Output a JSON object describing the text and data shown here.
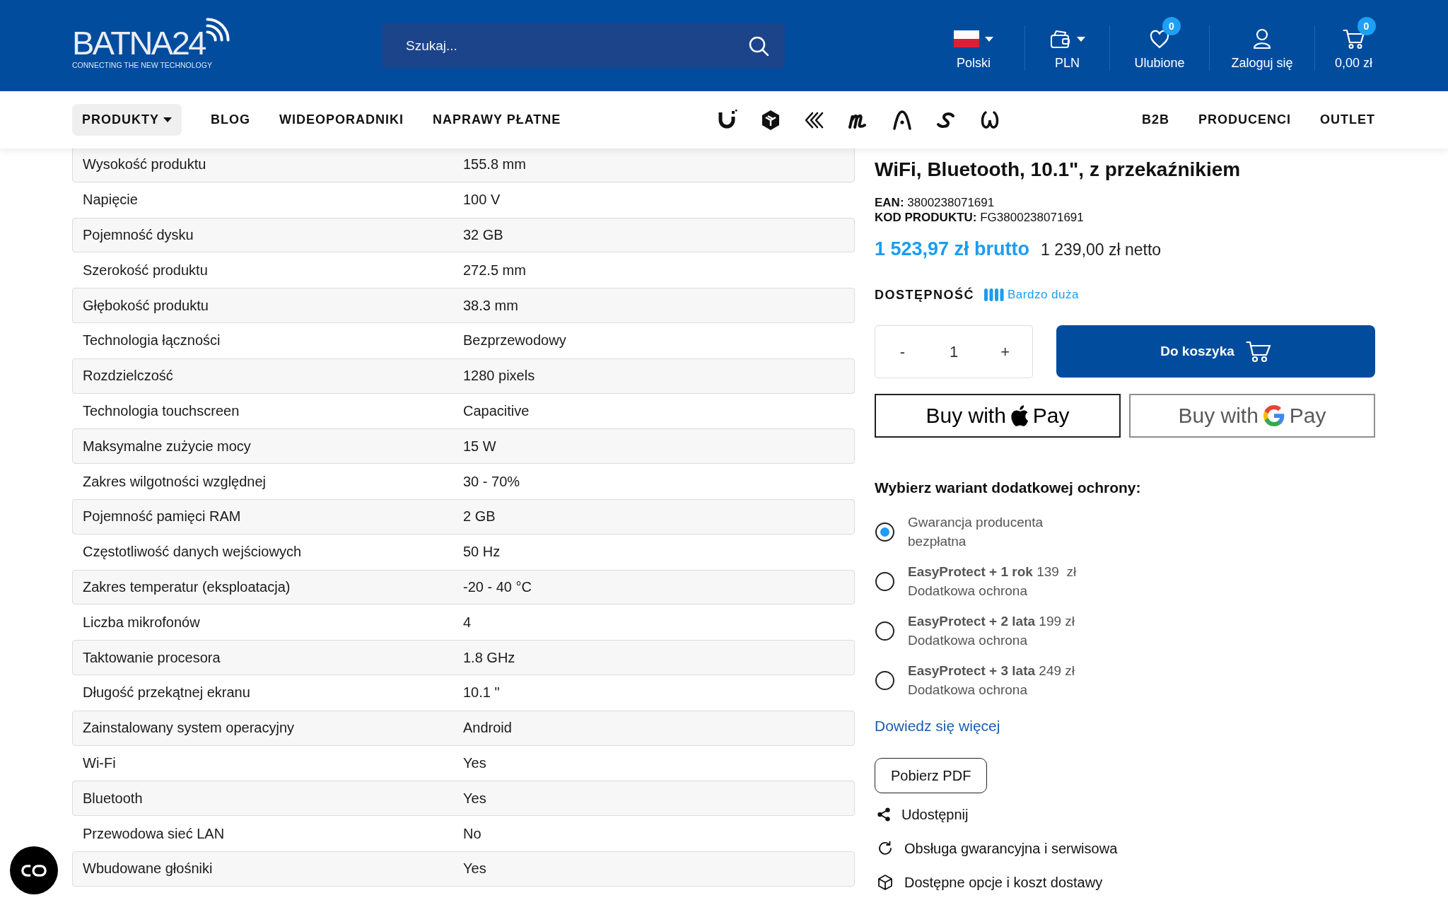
{
  "header": {
    "logo": {
      "wordmark": "BATNA24",
      "tagline": "CONNECTING THE NEW TECHNOLOGY"
    },
    "search": {
      "placeholder": "Szukaj..."
    },
    "actions": [
      {
        "kind": "language",
        "label": "Polski"
      },
      {
        "kind": "currency",
        "label": "PLN"
      },
      {
        "kind": "favorites",
        "label": "Ulubione",
        "badge": "0"
      },
      {
        "kind": "account",
        "label": "Zaloguj się"
      },
      {
        "kind": "cart",
        "label": "0,00 zł",
        "badge": "0"
      }
    ]
  },
  "nav": {
    "menu_button": "PRODUKTY",
    "links": [
      "BLOG",
      "WIDEOPORADNIKI",
      "NAPRAWY PŁATNE"
    ],
    "right_links": [
      "B2B",
      "PRODUCENCI",
      "OUTLET"
    ]
  },
  "specs": {
    "rows": [
      {
        "label": "Wysokość produktu",
        "value": "155.8 mm"
      },
      {
        "label": "Napięcie",
        "value": "100 V"
      },
      {
        "label": "Pojemność dysku",
        "value": "32 GB"
      },
      {
        "label": "Szerokość produktu",
        "value": "272.5 mm"
      },
      {
        "label": "Głębokość produktu",
        "value": "38.3 mm"
      },
      {
        "label": "Technologia łączności",
        "value": "Bezprzewodowy"
      },
      {
        "label": "Rozdzielczość",
        "value": "1280 pixels"
      },
      {
        "label": "Technologia touchscreen",
        "value": "Capacitive"
      },
      {
        "label": "Maksymalne zużycie mocy",
        "value": "15 W"
      },
      {
        "label": "Zakres wilgotności względnej",
        "value": "30 - 70%"
      },
      {
        "label": "Pojemność pamięci RAM",
        "value": "2 GB"
      },
      {
        "label": "Częstotliwość danych wejściowych",
        "value": "50 Hz"
      },
      {
        "label": "Zakres temperatur (eksploatacja)",
        "value": "-20 - 40 °C"
      },
      {
        "label": "Liczba mikrofonów",
        "value": "4"
      },
      {
        "label": "Taktowanie procesora",
        "value": "1.8 GHz"
      },
      {
        "label": "Długość przekątnej ekranu",
        "value": "10.1 \""
      },
      {
        "label": "Zainstalowany system operacyjny",
        "value": "Android"
      },
      {
        "label": "Wi-Fi",
        "value": "Yes"
      },
      {
        "label": "Bluetooth",
        "value": "Yes"
      },
      {
        "label": "Przewodowa sieć LAN",
        "value": "No"
      },
      {
        "label": "Wbudowane głośniki",
        "value": "Yes"
      }
    ]
  },
  "product": {
    "title": "WiFi, Bluetooth, 10.1\", z przekaźnikiem",
    "ean": "**EAN:** 3800238071691",
    "code": "**KOD PRODUKTU:** FG3800238071691",
    "price_gross": "1 523,97 zł brutto",
    "price_net": "1 239,00 zł netto",
    "availability": {
      "label": "DOSTĘPNOŚĆ",
      "value": "Bardzo duża"
    },
    "quantity": {
      "minus": "-",
      "value": "1",
      "plus": "+"
    },
    "add_to_cart": "Do koszyka",
    "pay_buttons": [
      {
        "kind": "apple",
        "prefix": "Buy with",
        "suffix": "Pay"
      },
      {
        "kind": "google",
        "prefix": "Buy with",
        "suffix": "Pay"
      }
    ],
    "protection": {
      "heading": "Wybierz wariant dodatkowej ochrony:",
      "options": [
        {
          "title": "Gwarancja producenta",
          "note": "bezpłatna",
          "selected": true
        },
        {
          "title": "**EasyProtect + 1 rok** 139  zł",
          "note": "Dodatkowa ochrona",
          "selected": false
        },
        {
          "title": "**EasyProtect + 2 lata** 199 zł",
          "note": "Dodatkowa ochrona",
          "selected": false
        },
        {
          "title": "**EasyProtect + 3 lata** 249 zł",
          "note": "Dodatkowa ochrona",
          "selected": false
        }
      ]
    },
    "learn_more": "Dowiedz się więcej",
    "pdf_button": "Pobierz PDF",
    "links": [
      {
        "kind": "share",
        "label": "Udostępnij"
      },
      {
        "kind": "warranty",
        "label": "Obsługa gwarancyjna i serwisowa"
      },
      {
        "kind": "delivery",
        "label": "Dostępne opcje i koszt dostawy"
      }
    ]
  }
}
